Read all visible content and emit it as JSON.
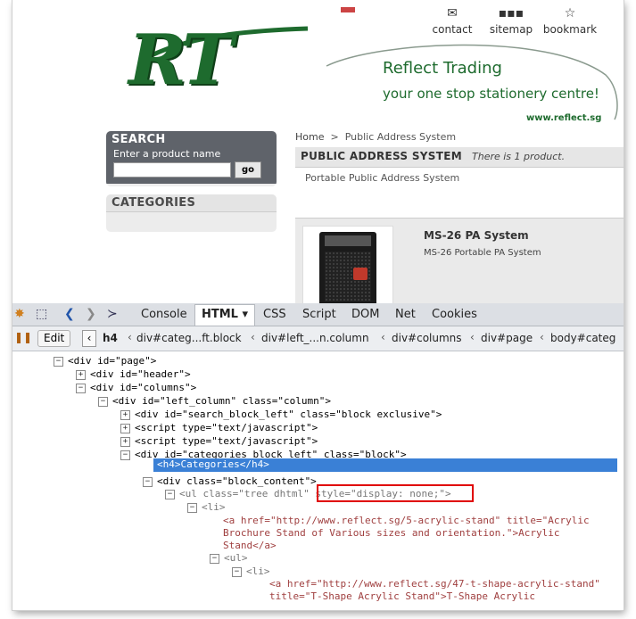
{
  "site": {
    "toplinks": [
      {
        "label": "contact",
        "icon": "envelope-icon"
      },
      {
        "label": "sitemap",
        "icon": "sitemap-icon"
      },
      {
        "label": "bookmark",
        "icon": "star-icon"
      }
    ],
    "logo": "RT",
    "brand_name": "Reflect Trading",
    "brand_tagline": "your one stop stationery centre!",
    "brand_url": "www.reflect.sg",
    "search": {
      "title": "SEARCH",
      "label": "Enter a product name",
      "button": "go",
      "value": ""
    },
    "categories_title": "CATEGORIES",
    "breadcrumb": {
      "home": "Home",
      "sep": ">",
      "current": "Public Address System"
    },
    "category": {
      "title": "PUBLIC ADDRESS SYSTEM",
      "count": "There is 1 product.",
      "description": "Portable Public Address System"
    },
    "product": {
      "name": "MS-26 PA System",
      "description": "MS-26 Portable PA System"
    }
  },
  "firebug": {
    "tabs": [
      "Console",
      "HTML",
      "CSS",
      "Script",
      "DOM",
      "Net",
      "Cookies"
    ],
    "active_tab": "HTML",
    "edit_label": "Edit",
    "breadcrumbs": [
      "h4",
      "div#categ...ft.block",
      "div#left_...n.column",
      "div#columns",
      "div#page",
      "body#categ"
    ],
    "tree": [
      {
        "t": "<div id=\"page\">"
      },
      {
        "t": "<div id=\"header\">"
      },
      {
        "t": "<div id=\"columns\">"
      },
      {
        "t": "<div id=\"left_column\" class=\"column\">"
      },
      {
        "t": "<div id=\"search_block_left\" class=\"block exclusive\">"
      },
      {
        "t": "<script type=\"text/javascript\">"
      },
      {
        "t": "<script type=\"text/javascript\">"
      },
      {
        "t": "<div id=\"categories_block_left\" class=\"block\">"
      },
      {
        "t": "<h4>Categories</h4>"
      },
      {
        "t": "<div class=\"block_content\">"
      },
      {
        "t": "<ul class=\"tree dhtml\" style=\"display: none;\">"
      },
      {
        "t": "<li>"
      },
      {
        "t": "<a href=\"http://www.reflect.sg/5-acrylic-stand\" title=\"Acrylic Brochure Stand of Various sizes and orientation.\">Acrylic Stand</a>"
      },
      {
        "t": "<ul>"
      },
      {
        "t": "<li>"
      },
      {
        "t": "<a href=\"http://www.reflect.sg/47-t-shape-acrylic-stand\" title=\"T-Shape Acrylic Stand\">T-Shape Acrylic"
      }
    ]
  }
}
